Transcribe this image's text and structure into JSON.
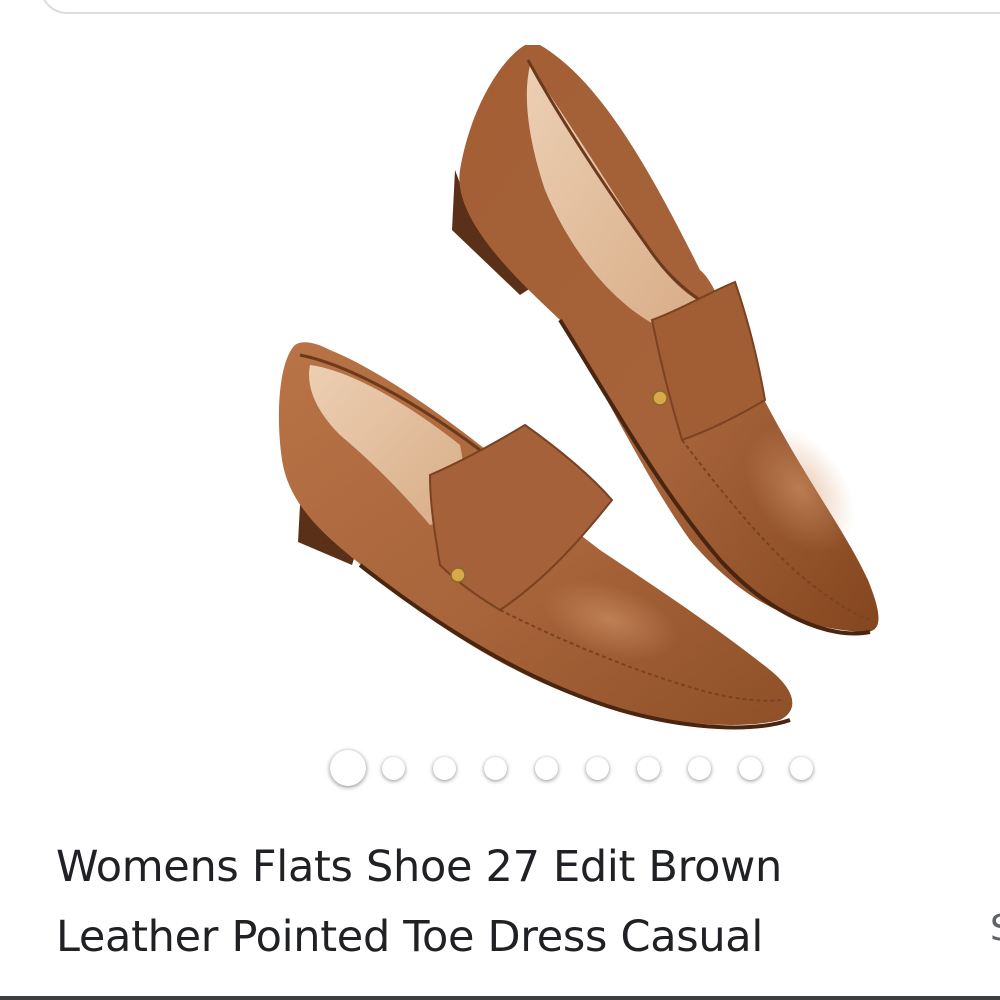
{
  "product": {
    "title": "Womens Flats Shoe 27 Edit Brown Leather Pointed Toe Dress Casual",
    "next_card_peek": "S"
  },
  "carousel": {
    "image_count": 10,
    "active_index": 0,
    "image_subject": "pair of brown leather pointed toe loafer flats"
  },
  "colors": {
    "leather": "#a8643a",
    "leather_dark": "#6b3a1c",
    "insole": "#e9c7a8",
    "title_text": "#202124",
    "search_border": "#dadce0"
  }
}
